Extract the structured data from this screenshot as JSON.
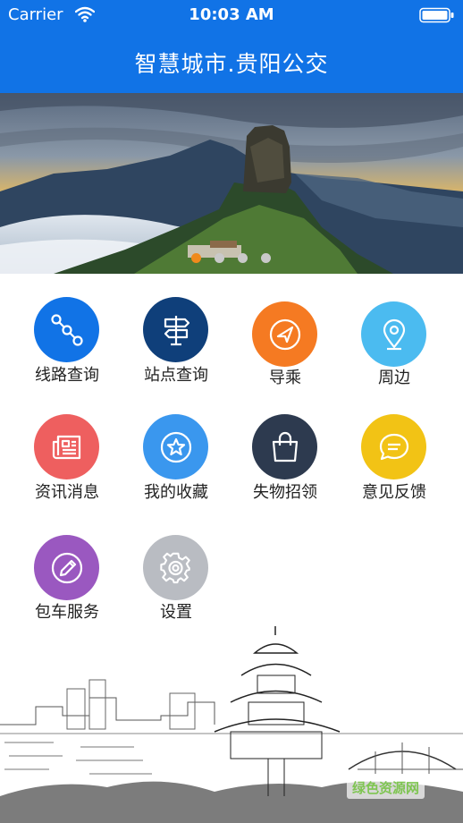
{
  "status_bar": {
    "carrier": "Carrier",
    "time": "10:03 AM"
  },
  "header": {
    "title": "智慧城市.贵阳公交",
    "bg_color": "#1173e6"
  },
  "banner": {
    "image": "mountain-landscape",
    "slide_count": 4,
    "active_slide": 1,
    "active_dot_color": "#f08a1c"
  },
  "menu": {
    "items": [
      {
        "label": "线路查询",
        "icon": "route-icon",
        "color": "#1173e6"
      },
      {
        "label": "站点查询",
        "icon": "signpost-icon",
        "color": "#0f3f7a"
      },
      {
        "label": "导乘",
        "icon": "navigation-icon",
        "color": "#f57a22"
      },
      {
        "label": "周边",
        "icon": "location-pin-icon",
        "color": "#4bbbf0"
      },
      {
        "label": "资讯消息",
        "icon": "newspaper-icon",
        "color": "#ee5f5f"
      },
      {
        "label": "我的收藏",
        "icon": "star-icon",
        "color": "#3a97ee"
      },
      {
        "label": "失物招领",
        "icon": "shopping-bag-icon",
        "color": "#2d3a4f"
      },
      {
        "label": "意见反馈",
        "icon": "chat-bubble-icon",
        "color": "#f2c315"
      },
      {
        "label": "包车服务",
        "icon": "edit-pencil-icon",
        "color": "#9a58c0"
      },
      {
        "label": "设置",
        "icon": "gear-icon",
        "color": "#b9bcc2"
      }
    ]
  },
  "footer": {
    "watermark": "绿色资源网"
  }
}
